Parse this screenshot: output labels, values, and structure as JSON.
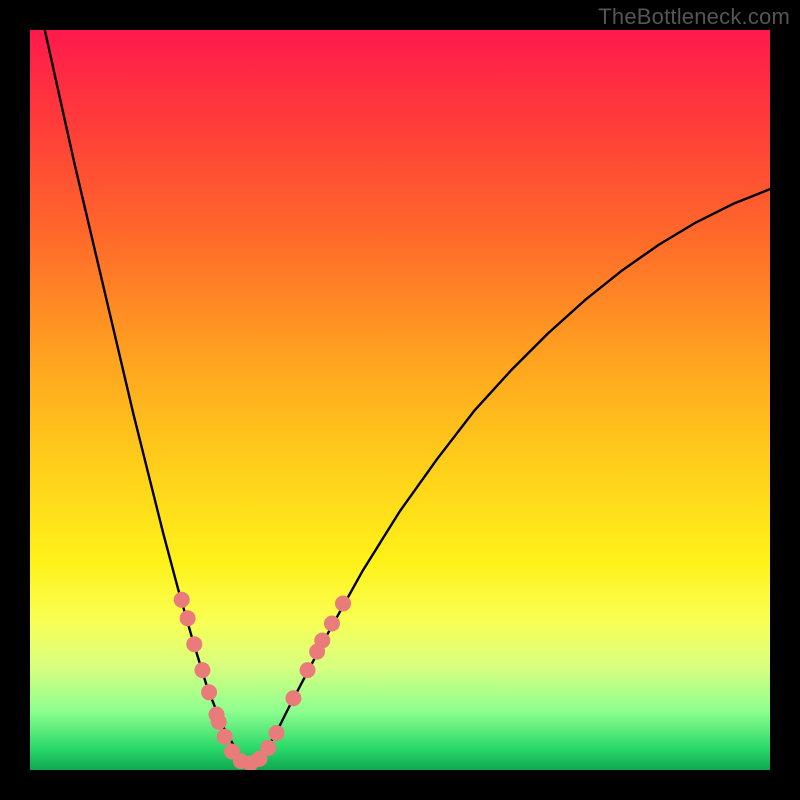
{
  "watermark": "TheBottleneck.com",
  "chart_data": {
    "type": "line",
    "title": "",
    "xlabel": "",
    "ylabel": "",
    "xlim": [
      0,
      100
    ],
    "ylim": [
      0,
      100
    ],
    "grid": false,
    "legend": false,
    "series": [
      {
        "name": "curve",
        "x": [
          2,
          4,
          6,
          8,
          10,
          12,
          14,
          16,
          18,
          20,
          22,
          24,
          26,
          28,
          29.3,
          31,
          33,
          35,
          40,
          45,
          50,
          55,
          60,
          65,
          70,
          75,
          80,
          85,
          90,
          95,
          100
        ],
        "y": [
          100,
          91,
          82,
          73.5,
          65,
          56.5,
          48,
          40,
          32,
          24.5,
          17.5,
          11,
          6,
          2.5,
          0.8,
          1.5,
          4.5,
          8.5,
          18,
          27,
          35,
          42,
          48.5,
          54,
          59,
          63.5,
          67.5,
          71,
          74,
          76.5,
          78.5
        ],
        "color": "#000000"
      }
    ],
    "markers": {
      "name": "dots",
      "color": "#e97b7b",
      "radius_px": 8,
      "points": [
        {
          "x": 20.5,
          "y": 23.0
        },
        {
          "x": 21.3,
          "y": 20.5
        },
        {
          "x": 22.2,
          "y": 17.0
        },
        {
          "x": 23.3,
          "y": 13.5
        },
        {
          "x": 24.2,
          "y": 10.5
        },
        {
          "x": 25.2,
          "y": 7.5
        },
        {
          "x": 25.5,
          "y": 6.5
        },
        {
          "x": 26.3,
          "y": 4.5
        },
        {
          "x": 27.3,
          "y": 2.5
        },
        {
          "x": 28.5,
          "y": 1.2
        },
        {
          "x": 29.8,
          "y": 0.9
        },
        {
          "x": 31.0,
          "y": 1.5
        },
        {
          "x": 32.2,
          "y": 3.0
        },
        {
          "x": 33.3,
          "y": 5.0
        },
        {
          "x": 35.6,
          "y": 9.7
        },
        {
          "x": 37.5,
          "y": 13.5
        },
        {
          "x": 38.8,
          "y": 16.0
        },
        {
          "x": 39.5,
          "y": 17.5
        },
        {
          "x": 40.8,
          "y": 19.8
        },
        {
          "x": 42.3,
          "y": 22.5
        }
      ]
    }
  }
}
